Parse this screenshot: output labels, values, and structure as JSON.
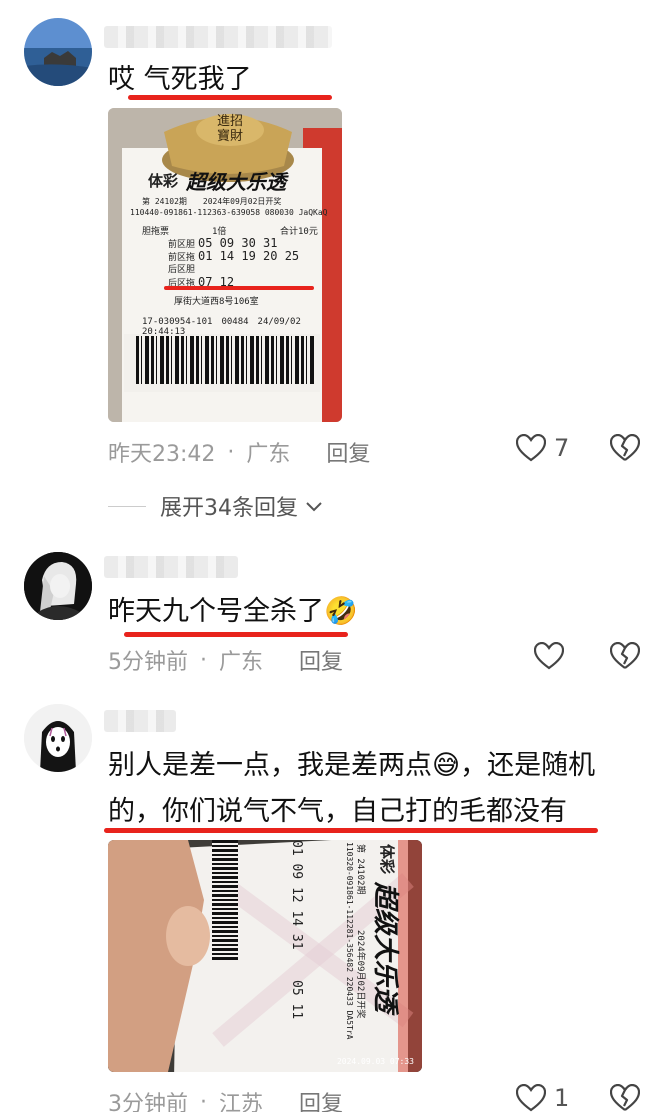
{
  "comments": [
    {
      "text": "哎 气死我了",
      "time": "昨天23:42",
      "location": "广东",
      "reply_label": "回复",
      "likes": "7",
      "ticket": {
        "ingot_line1": "進招",
        "ingot_line2": "寶財",
        "brand": "体彩",
        "game": "超级大乐透",
        "issue_line": "第 24102期　　2024年09月02日开奖",
        "serial_line": "110440-091861-112363-639058 080030 JaQKaQ",
        "type_label": "胆拖票",
        "multiple": "1倍",
        "total": "合计10元",
        "rows": [
          {
            "label": "前区胆",
            "nums": "05 09 30 31"
          },
          {
            "label": "前区拖",
            "nums": "01 14 19 20 25"
          },
          {
            "label": "后区胆",
            "nums": ""
          },
          {
            "label": "后区拖",
            "nums": "07 12"
          }
        ],
        "address": "厚街大道西8号106室",
        "station_line": "17-030954-101　00484　24/09/02 20:44:13"
      },
      "expand_label": "展开34条回复"
    },
    {
      "text": "昨天九个号全杀了",
      "emoji": "🤣",
      "time": "5分钟前",
      "location": "广东",
      "reply_label": "回复"
    },
    {
      "text_line1": "别人是差一点，我是差两点",
      "emoji": "😅",
      "text_line1_tail": "，还是随机",
      "text_line2": "的，你们说气不气，自己打的毛都没有",
      "time": "3分钟前",
      "location": "江苏",
      "reply_label": "回复",
      "likes": "1",
      "ticket": {
        "brand": "体彩",
        "game": "超级大乐透",
        "issue_line": "第 24102期",
        "date_line": "2024年09月02日开奖",
        "serial_line": "110320-091861-112281-356482 220433 DA5TrA",
        "nums": "01 09 12 14 31",
        "back": "05 11",
        "stamp": "2024.09.03 07:33"
      }
    }
  ],
  "colors": {
    "underline": "#e8231c",
    "meta_text": "#9a9a9a"
  }
}
